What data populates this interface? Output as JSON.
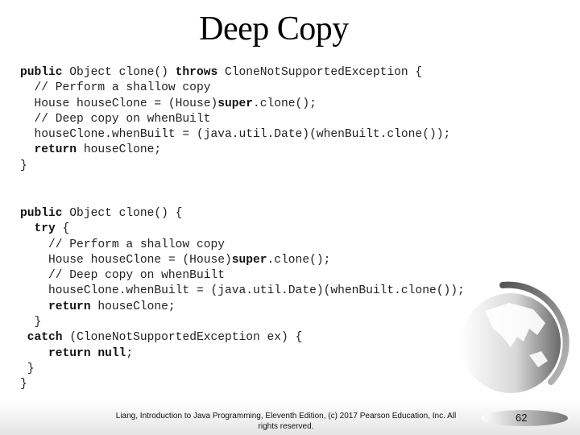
{
  "slide": {
    "title": "Deep Copy",
    "code_block_1": [
      [
        {
          "t": "public",
          "b": true
        },
        {
          "t": " Object clone() "
        },
        {
          "t": "throws",
          "b": true
        },
        {
          "t": " CloneNotSupportedException {"
        }
      ],
      [
        {
          "t": "  // Perform a shallow copy"
        }
      ],
      [
        {
          "t": "  House houseClone = (House)"
        },
        {
          "t": "super",
          "b": true
        },
        {
          "t": ".clone();"
        }
      ],
      [
        {
          "t": "  // Deep copy on whenBuilt"
        }
      ],
      [
        {
          "t": "  houseClone.whenBuilt = (java.util.Date)(whenBuilt.clone());"
        }
      ],
      [
        {
          "t": "  "
        },
        {
          "t": "return",
          "b": true
        },
        {
          "t": " houseClone;"
        }
      ],
      [
        {
          "t": "}"
        }
      ]
    ],
    "code_block_2": [
      [
        {
          "t": "public",
          "b": true
        },
        {
          "t": " Object clone() {"
        }
      ],
      [
        {
          "t": "  "
        },
        {
          "t": "try",
          "b": true
        },
        {
          "t": " {"
        }
      ],
      [
        {
          "t": "    // Perform a shallow copy"
        }
      ],
      [
        {
          "t": "    House houseClone = (House)"
        },
        {
          "t": "super",
          "b": true
        },
        {
          "t": ".clone();"
        }
      ],
      [
        {
          "t": "    // Deep copy on whenBuilt"
        }
      ],
      [
        {
          "t": "    houseClone.whenBuilt = (java.util.Date)(whenBuilt.clone());"
        }
      ],
      [
        {
          "t": "    "
        },
        {
          "t": "return",
          "b": true
        },
        {
          "t": " houseClone;"
        }
      ],
      [
        {
          "t": "  }"
        }
      ],
      [
        {
          "t": " "
        },
        {
          "t": "catch",
          "b": true
        },
        {
          "t": " (CloneNotSupportedException ex) {"
        }
      ],
      [
        {
          "t": "    "
        },
        {
          "t": "return",
          "b": true
        },
        {
          "t": " "
        },
        {
          "t": "null",
          "b": true
        },
        {
          "t": ";"
        }
      ],
      [
        {
          "t": " }"
        }
      ],
      [
        {
          "t": "}"
        }
      ]
    ],
    "footer_line_1": "Liang, Introduction to Java Programming, Eleventh Edition, (c) 2017 Pearson Education, Inc. All",
    "footer_line_2": "rights reserved.",
    "page_number": "62",
    "decoration_icon": "globe-icon"
  }
}
